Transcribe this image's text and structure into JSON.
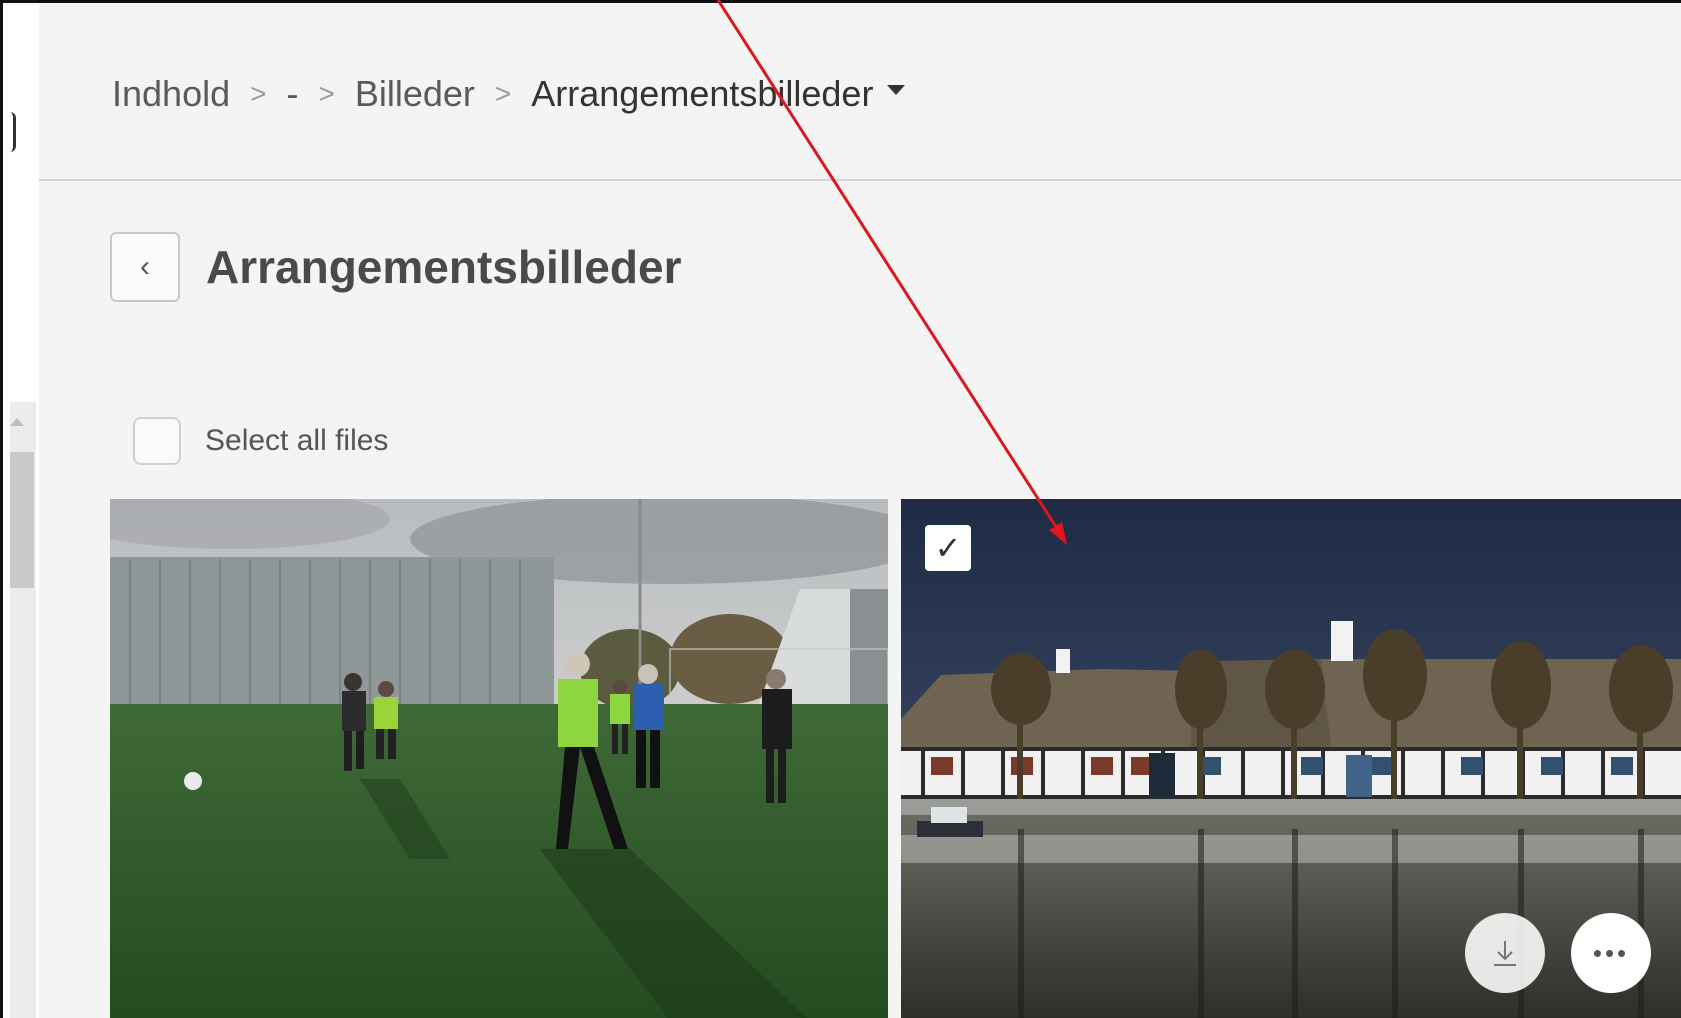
{
  "breadcrumb": {
    "items": [
      "Indhold",
      "-",
      "Billeder"
    ],
    "current": "Arrangementsbilleder",
    "separator": ">"
  },
  "page": {
    "title": "Arrangementsbilleder",
    "back_glyph": "‹"
  },
  "select_all": {
    "label": "Select all files",
    "checked": false
  },
  "tiles": [
    {
      "description": "football-field-photo",
      "selected": false
    },
    {
      "description": "thatched-houses-pond-photo",
      "selected": true,
      "check_glyph": "✓",
      "more_glyph": "•••"
    }
  ],
  "icons": {
    "download": "download-icon",
    "more": "more-icon",
    "checkmark": "checkmark-icon",
    "back": "chevron-left-icon",
    "dropdown": "caret-down-icon"
  },
  "colors": {
    "annotation_arrow": "#e0161e",
    "app_background": "#f4f4f4"
  }
}
